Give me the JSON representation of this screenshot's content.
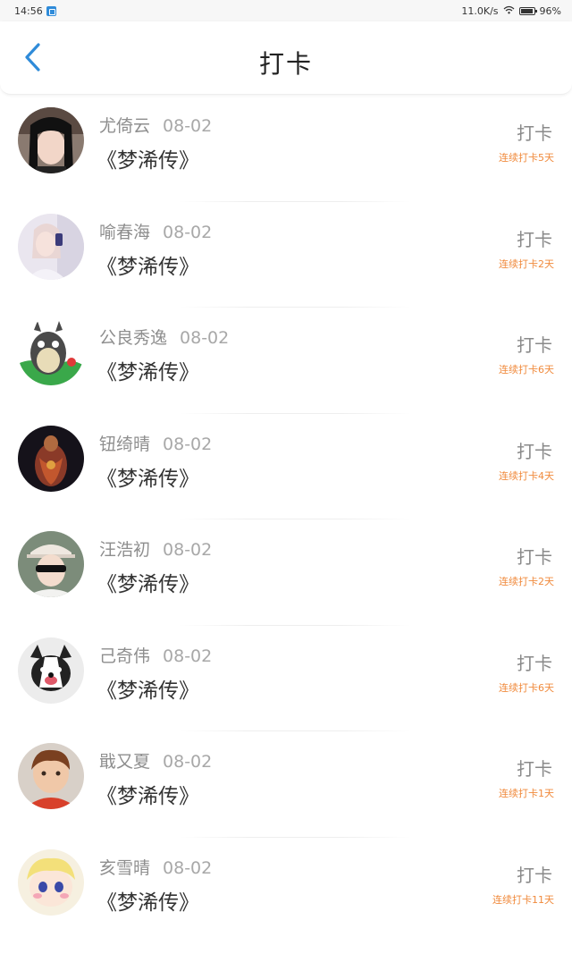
{
  "status_bar": {
    "time": "14:56",
    "network_speed": "11.0K/s",
    "battery": "96%"
  },
  "header": {
    "title": "打卡",
    "back_icon": "chevron-left-icon"
  },
  "colors": {
    "accent": "#2f8bd9",
    "streak": "#f08a3c",
    "name": "#8e8e8e",
    "book": "#333333"
  },
  "items": [
    {
      "name": "尤倚云",
      "date": "08-02",
      "book": "《梦浠传》",
      "action": "打卡",
      "streak": "连续打卡5天"
    },
    {
      "name": "喻春海",
      "date": "08-02",
      "book": "《梦浠传》",
      "action": "打卡",
      "streak": "连续打卡2天"
    },
    {
      "name": "公良秀逸",
      "date": "08-02",
      "book": "《梦浠传》",
      "action": "打卡",
      "streak": "连续打卡6天"
    },
    {
      "name": "钮绮晴",
      "date": "08-02",
      "book": "《梦浠传》",
      "action": "打卡",
      "streak": "连续打卡4天"
    },
    {
      "name": "汪浩初",
      "date": "08-02",
      "book": "《梦浠传》",
      "action": "打卡",
      "streak": "连续打卡2天"
    },
    {
      "name": "己奇伟",
      "date": "08-02",
      "book": "《梦浠传》",
      "action": "打卡",
      "streak": "连续打卡6天"
    },
    {
      "name": "戢又夏",
      "date": "08-02",
      "book": "《梦浠传》",
      "action": "打卡",
      "streak": "连续打卡1天"
    },
    {
      "name": "亥雪晴",
      "date": "08-02",
      "book": "《梦浠传》",
      "action": "打卡",
      "streak": "连续打卡11天"
    }
  ]
}
